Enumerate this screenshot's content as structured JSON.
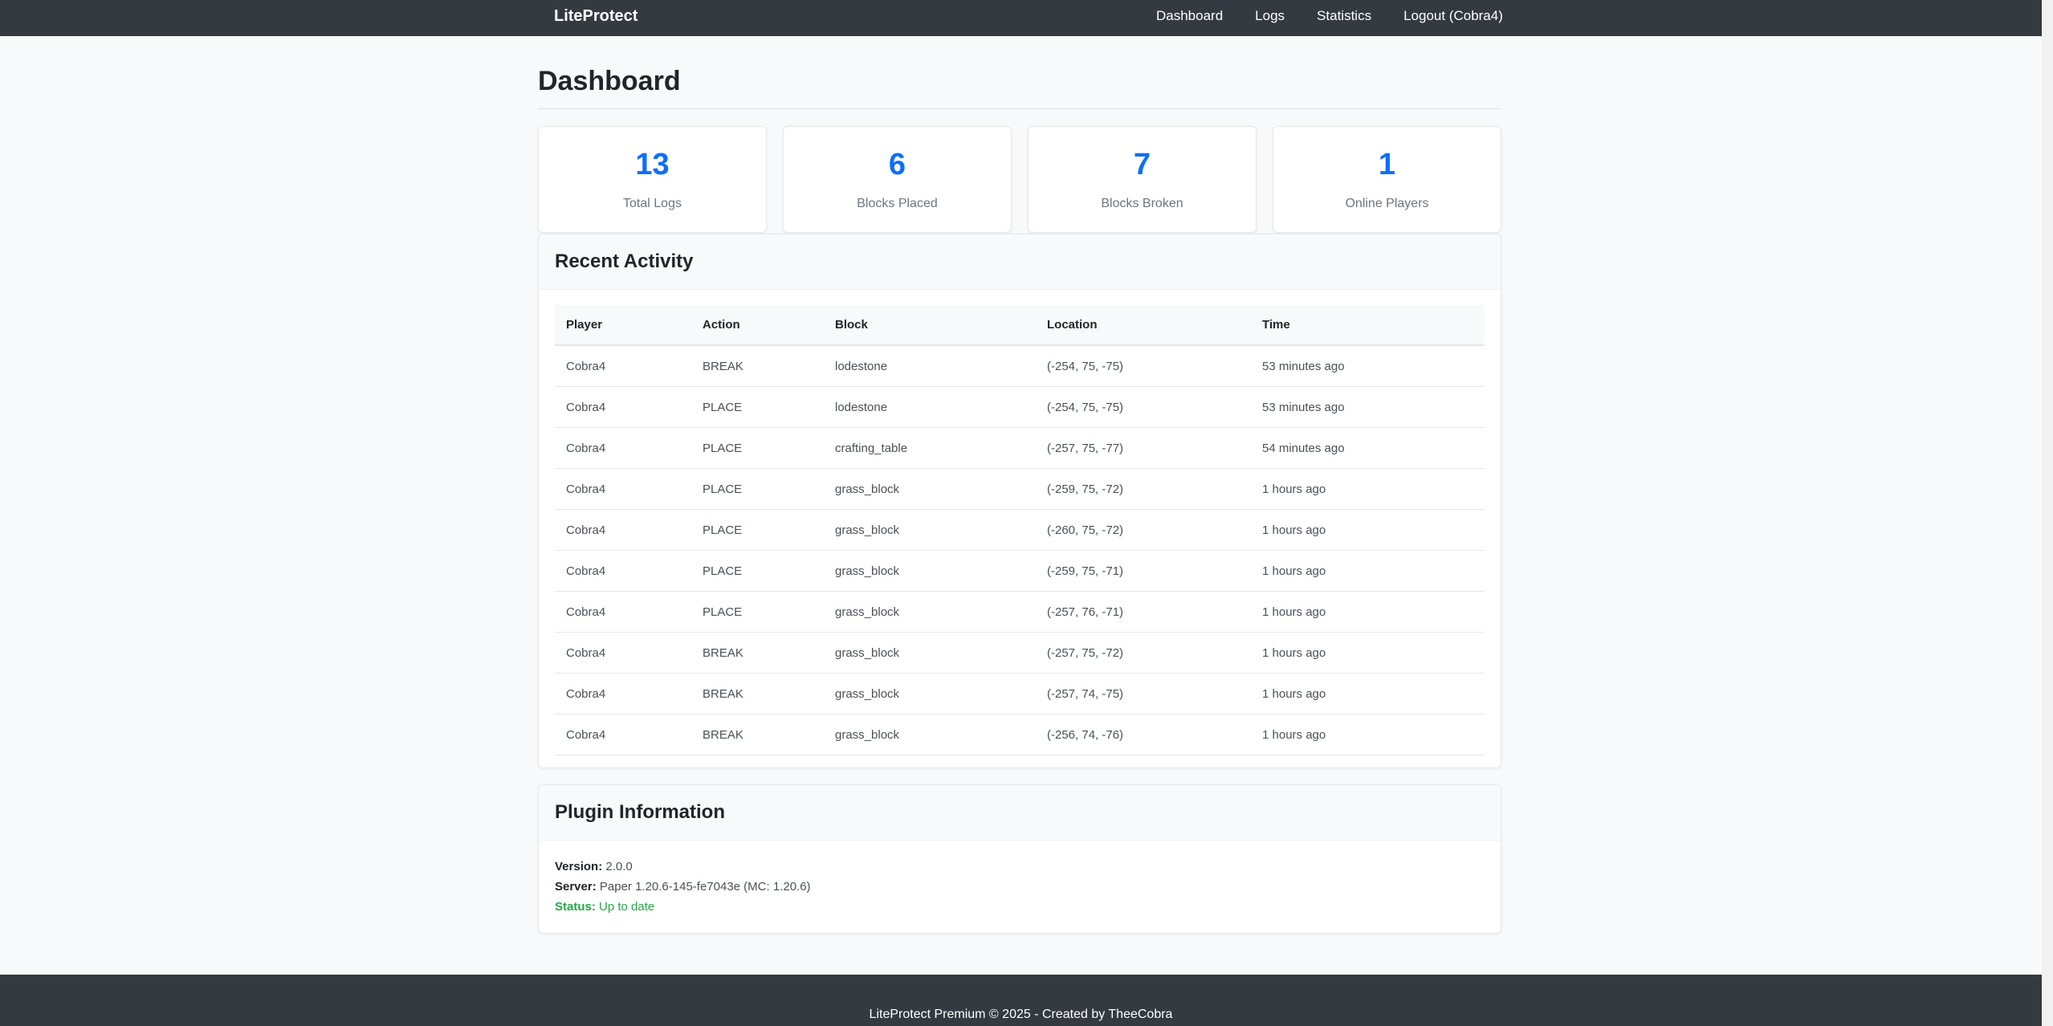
{
  "navbar": {
    "brand": "LiteProtect",
    "links": [
      "Dashboard",
      "Logs",
      "Statistics",
      "Logout (Cobra4)"
    ]
  },
  "page": {
    "title": "Dashboard"
  },
  "stats": [
    {
      "value": "13",
      "label": "Total Logs"
    },
    {
      "value": "6",
      "label": "Blocks Placed"
    },
    {
      "value": "7",
      "label": "Blocks Broken"
    },
    {
      "value": "1",
      "label": "Online Players"
    }
  ],
  "activity": {
    "title": "Recent Activity",
    "columns": [
      "Player",
      "Action",
      "Block",
      "Location",
      "Time"
    ],
    "rows": [
      [
        "Cobra4",
        "BREAK",
        "lodestone",
        "(-254, 75, -75)",
        "53 minutes ago"
      ],
      [
        "Cobra4",
        "PLACE",
        "lodestone",
        "(-254, 75, -75)",
        "53 minutes ago"
      ],
      [
        "Cobra4",
        "PLACE",
        "crafting_table",
        "(-257, 75, -77)",
        "54 minutes ago"
      ],
      [
        "Cobra4",
        "PLACE",
        "grass_block",
        "(-259, 75, -72)",
        "1 hours ago"
      ],
      [
        "Cobra4",
        "PLACE",
        "grass_block",
        "(-260, 75, -72)",
        "1 hours ago"
      ],
      [
        "Cobra4",
        "PLACE",
        "grass_block",
        "(-259, 75, -71)",
        "1 hours ago"
      ],
      [
        "Cobra4",
        "PLACE",
        "grass_block",
        "(-257, 76, -71)",
        "1 hours ago"
      ],
      [
        "Cobra4",
        "BREAK",
        "grass_block",
        "(-257, 75, -72)",
        "1 hours ago"
      ],
      [
        "Cobra4",
        "BREAK",
        "grass_block",
        "(-257, 74, -75)",
        "1 hours ago"
      ],
      [
        "Cobra4",
        "BREAK",
        "grass_block",
        "(-256, 74, -76)",
        "1 hours ago"
      ]
    ]
  },
  "plugin": {
    "title": "Plugin Information",
    "version_label": "Version:",
    "version": "2.0.0",
    "server_label": "Server:",
    "server": "Paper 1.20.6-145-fe7043e (MC: 1.20.6)",
    "status_label": "Status:",
    "status": "Up to date",
    "status_color": "#28a745"
  },
  "footer": {
    "text": "LiteProtect Premium © 2025 - Created by TheeCobra"
  },
  "colors": {
    "navbar": "#343a40",
    "accent": "#0d6efd",
    "background": "#f8f9fa"
  }
}
